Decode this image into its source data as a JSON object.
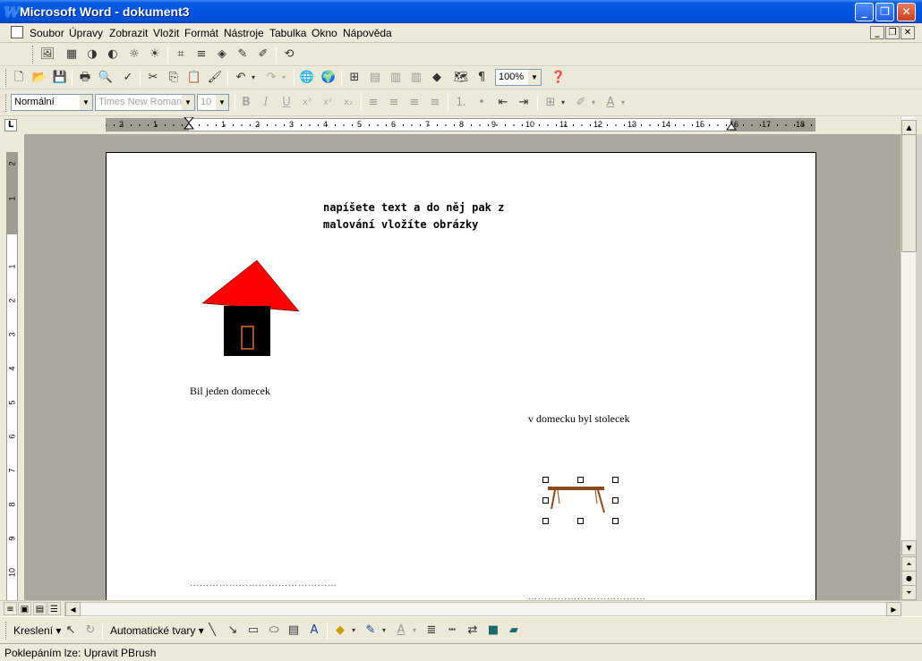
{
  "window": {
    "title": "Microsoft Word - dokument3",
    "app_icon_glyph": "W"
  },
  "menu": {
    "items": [
      "Soubor",
      "Úpravy",
      "Zobrazit",
      "Vložit",
      "Formát",
      "Nástroje",
      "Tabulka",
      "Okno",
      "Nápověda"
    ]
  },
  "formatting": {
    "style": "Normální",
    "font": "Times New Roman",
    "size": "10",
    "zoom": "100%"
  },
  "ruler": {
    "h_numbers": [
      "2",
      "1",
      "1",
      "2",
      "3",
      "4",
      "5",
      "6",
      "7",
      "8",
      "9",
      "10",
      "11",
      "12",
      "13",
      "14",
      "15",
      "16",
      "17",
      "18"
    ],
    "v_numbers": [
      "2",
      "1",
      "1",
      "2",
      "3",
      "4",
      "5",
      "6",
      "7",
      "8",
      "9",
      "10"
    ]
  },
  "document": {
    "note_line1": "napíšete text a do něj pak z",
    "note_line2": "malování vložíte obrázky",
    "caption_house": "Bil jeden domecek",
    "caption_table": "v domecku byl stolecek",
    "dotted_line_1": "………………………………………",
    "dotted_line_2": "………………………………"
  },
  "drawing_toolbar": {
    "draw_label": "Kreslení",
    "autoshapes_label": "Automatické tvary"
  },
  "status": {
    "text": "Poklepáním lze:  Upravit PBrush"
  },
  "colors": {
    "titlebar": "#0054e3",
    "roof": "#ff0000",
    "house_body": "#000000",
    "door": "#a0522d",
    "table": "#8b4a1a",
    "doc_background": "#a9a79e"
  }
}
